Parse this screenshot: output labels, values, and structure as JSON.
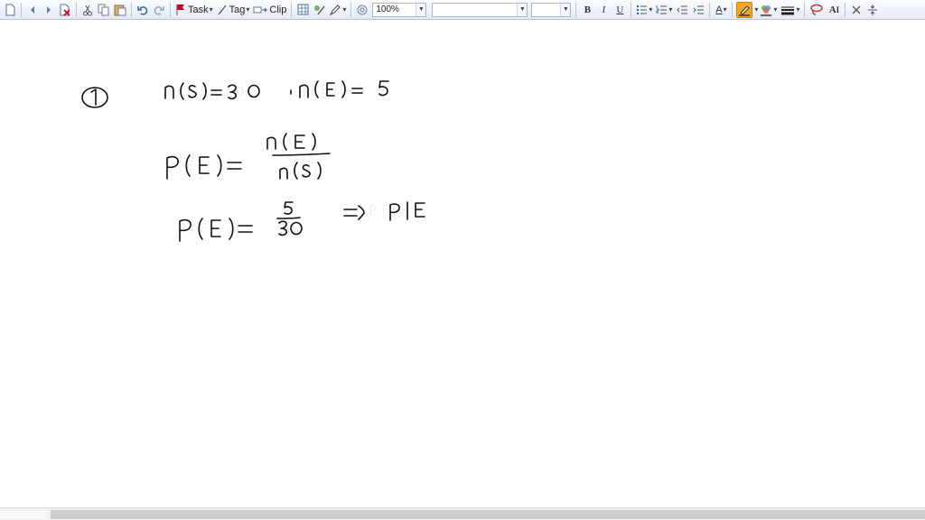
{
  "toolbar": {
    "task_label": "Task",
    "tag_label": "Tag",
    "clip_label": "Clip",
    "zoom_value": "100%",
    "font_name_value": "",
    "font_size_value": "",
    "bold_label": "B",
    "italic_label": "I",
    "underline_label": "U",
    "font_color_glyph": "A",
    "text_style_glyph": "A",
    "colors": {
      "highlight": "#f5a623",
      "task_flag": "#d0021b",
      "accent": "#2f5fa7"
    },
    "icons": [
      "new-page-icon",
      "back-icon",
      "forward-icon",
      "delete-page-icon",
      "cut-icon",
      "copy-icon",
      "paste-icon",
      "undo-icon",
      "redo-icon",
      "task-flag-icon",
      "tag-pencil-icon",
      "clip-icon",
      "table-icon",
      "draw-tools-icon",
      "pen-icon",
      "at-sign-icon",
      "bullet-list-icon",
      "numbered-list-icon",
      "decrease-indent-icon",
      "increase-indent-icon",
      "font-color-icon",
      "highlighter-icon",
      "fill-color-icon",
      "line-style-icon",
      "lasso-icon",
      "text-style-icon",
      "close-x-icon",
      "split-icon"
    ]
  },
  "handwriting": {
    "problem_number": "1",
    "line1_left": "n(S)=30",
    "line1_right": "n(E)=5",
    "line2_lhs": "P(E) =",
    "line2_numerator": "n(E)",
    "line2_denominator": "n(S)",
    "line3_lhs": "P(E) =",
    "line3_numerator": "5",
    "line3_denominator": "30",
    "line3_result": "⇒ P(E"
  }
}
